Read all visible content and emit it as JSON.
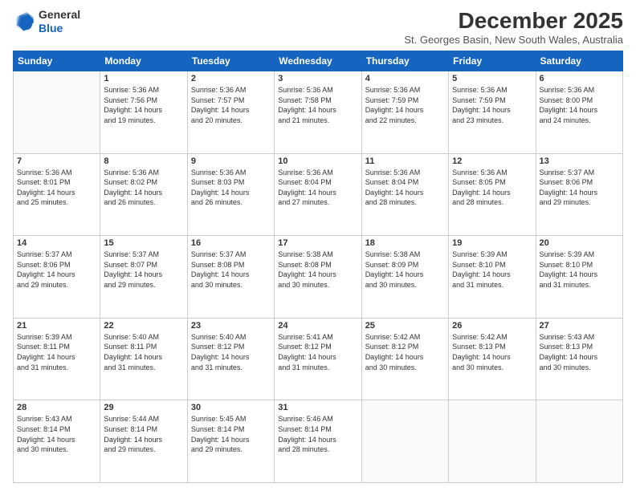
{
  "logo": {
    "general": "General",
    "blue": "Blue"
  },
  "title": "December 2025",
  "subtitle": "St. Georges Basin, New South Wales, Australia",
  "headers": [
    "Sunday",
    "Monday",
    "Tuesday",
    "Wednesday",
    "Thursday",
    "Friday",
    "Saturday"
  ],
  "weeks": [
    [
      {
        "day": "",
        "info": ""
      },
      {
        "day": "1",
        "info": "Sunrise: 5:36 AM\nSunset: 7:56 PM\nDaylight: 14 hours\nand 19 minutes."
      },
      {
        "day": "2",
        "info": "Sunrise: 5:36 AM\nSunset: 7:57 PM\nDaylight: 14 hours\nand 20 minutes."
      },
      {
        "day": "3",
        "info": "Sunrise: 5:36 AM\nSunset: 7:58 PM\nDaylight: 14 hours\nand 21 minutes."
      },
      {
        "day": "4",
        "info": "Sunrise: 5:36 AM\nSunset: 7:59 PM\nDaylight: 14 hours\nand 22 minutes."
      },
      {
        "day": "5",
        "info": "Sunrise: 5:36 AM\nSunset: 7:59 PM\nDaylight: 14 hours\nand 23 minutes."
      },
      {
        "day": "6",
        "info": "Sunrise: 5:36 AM\nSunset: 8:00 PM\nDaylight: 14 hours\nand 24 minutes."
      }
    ],
    [
      {
        "day": "7",
        "info": "Sunrise: 5:36 AM\nSunset: 8:01 PM\nDaylight: 14 hours\nand 25 minutes."
      },
      {
        "day": "8",
        "info": "Sunrise: 5:36 AM\nSunset: 8:02 PM\nDaylight: 14 hours\nand 26 minutes."
      },
      {
        "day": "9",
        "info": "Sunrise: 5:36 AM\nSunset: 8:03 PM\nDaylight: 14 hours\nand 26 minutes."
      },
      {
        "day": "10",
        "info": "Sunrise: 5:36 AM\nSunset: 8:04 PM\nDaylight: 14 hours\nand 27 minutes."
      },
      {
        "day": "11",
        "info": "Sunrise: 5:36 AM\nSunset: 8:04 PM\nDaylight: 14 hours\nand 28 minutes."
      },
      {
        "day": "12",
        "info": "Sunrise: 5:36 AM\nSunset: 8:05 PM\nDaylight: 14 hours\nand 28 minutes."
      },
      {
        "day": "13",
        "info": "Sunrise: 5:37 AM\nSunset: 8:06 PM\nDaylight: 14 hours\nand 29 minutes."
      }
    ],
    [
      {
        "day": "14",
        "info": "Sunrise: 5:37 AM\nSunset: 8:06 PM\nDaylight: 14 hours\nand 29 minutes."
      },
      {
        "day": "15",
        "info": "Sunrise: 5:37 AM\nSunset: 8:07 PM\nDaylight: 14 hours\nand 29 minutes."
      },
      {
        "day": "16",
        "info": "Sunrise: 5:37 AM\nSunset: 8:08 PM\nDaylight: 14 hours\nand 30 minutes."
      },
      {
        "day": "17",
        "info": "Sunrise: 5:38 AM\nSunset: 8:08 PM\nDaylight: 14 hours\nand 30 minutes."
      },
      {
        "day": "18",
        "info": "Sunrise: 5:38 AM\nSunset: 8:09 PM\nDaylight: 14 hours\nand 30 minutes."
      },
      {
        "day": "19",
        "info": "Sunrise: 5:39 AM\nSunset: 8:10 PM\nDaylight: 14 hours\nand 31 minutes."
      },
      {
        "day": "20",
        "info": "Sunrise: 5:39 AM\nSunset: 8:10 PM\nDaylight: 14 hours\nand 31 minutes."
      }
    ],
    [
      {
        "day": "21",
        "info": "Sunrise: 5:39 AM\nSunset: 8:11 PM\nDaylight: 14 hours\nand 31 minutes."
      },
      {
        "day": "22",
        "info": "Sunrise: 5:40 AM\nSunset: 8:11 PM\nDaylight: 14 hours\nand 31 minutes."
      },
      {
        "day": "23",
        "info": "Sunrise: 5:40 AM\nSunset: 8:12 PM\nDaylight: 14 hours\nand 31 minutes."
      },
      {
        "day": "24",
        "info": "Sunrise: 5:41 AM\nSunset: 8:12 PM\nDaylight: 14 hours\nand 31 minutes."
      },
      {
        "day": "25",
        "info": "Sunrise: 5:42 AM\nSunset: 8:12 PM\nDaylight: 14 hours\nand 30 minutes."
      },
      {
        "day": "26",
        "info": "Sunrise: 5:42 AM\nSunset: 8:13 PM\nDaylight: 14 hours\nand 30 minutes."
      },
      {
        "day": "27",
        "info": "Sunrise: 5:43 AM\nSunset: 8:13 PM\nDaylight: 14 hours\nand 30 minutes."
      }
    ],
    [
      {
        "day": "28",
        "info": "Sunrise: 5:43 AM\nSunset: 8:14 PM\nDaylight: 14 hours\nand 30 minutes."
      },
      {
        "day": "29",
        "info": "Sunrise: 5:44 AM\nSunset: 8:14 PM\nDaylight: 14 hours\nand 29 minutes."
      },
      {
        "day": "30",
        "info": "Sunrise: 5:45 AM\nSunset: 8:14 PM\nDaylight: 14 hours\nand 29 minutes."
      },
      {
        "day": "31",
        "info": "Sunrise: 5:46 AM\nSunset: 8:14 PM\nDaylight: 14 hours\nand 28 minutes."
      },
      {
        "day": "",
        "info": ""
      },
      {
        "day": "",
        "info": ""
      },
      {
        "day": "",
        "info": ""
      }
    ]
  ]
}
